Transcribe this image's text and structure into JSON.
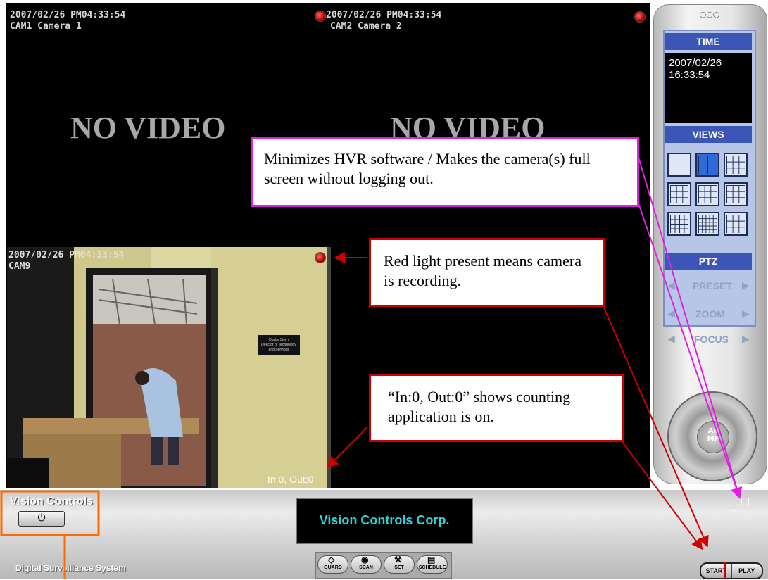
{
  "cameras": [
    {
      "timestamp": "2007/02/26 PM04:33:54",
      "name": "CAM1 Camera 1",
      "status": "NO VIDEO"
    },
    {
      "timestamp": "2007/02/26 PM04:33:54",
      "name": "CAM2 Camera 2",
      "status": "NO VIDEO"
    },
    {
      "timestamp": "2007/02/26 PM04:33:54",
      "name": "CAM9",
      "counter": "In:0, Out:0",
      "door_sign": [
        "Dustin Stern",
        "Director of Technology",
        "and Services"
      ]
    }
  ],
  "side_panel": {
    "dots": "○○○",
    "time_header": "TIME",
    "date": "2007/02/26",
    "time": "16:33:54",
    "views_header": "VIEWS",
    "ptz_header": "PTZ",
    "preset": "PRESET",
    "zoom": "ZOOM",
    "focus": "FOCUS",
    "af": "AF",
    "mf": "MF"
  },
  "window_controls": {
    "minimize": "_",
    "maximize": "□"
  },
  "bottom_bar": {
    "brand": "Vision Controls",
    "subtitle": "Digital Surveillance System",
    "display": "Vision Controls Corp.",
    "toolbar": [
      "GUARD",
      "SCAN",
      "SET",
      "SCHEDULE"
    ],
    "start": "START",
    "play": "PLAY"
  },
  "callouts": {
    "minimize": "Minimizes HVR software / Makes the camera(s) full screen without logging out.",
    "recording": "Red light present means camera is recording.",
    "counting": "“In:0, Out:0” shows counting application is on."
  },
  "colors": {
    "callout_red": "#d10000",
    "callout_magenta": "#e020e0",
    "callout_orange": "#ff6a00",
    "panel_blue": "#3c56b8",
    "display_text": "#2ed0d8"
  },
  "icons": [
    "power-icon",
    "guard-icon",
    "scan-icon",
    "set-icon",
    "schedule-icon",
    "record-light-icon",
    "view-layout-icon",
    "ptz-joystick-icon"
  ]
}
